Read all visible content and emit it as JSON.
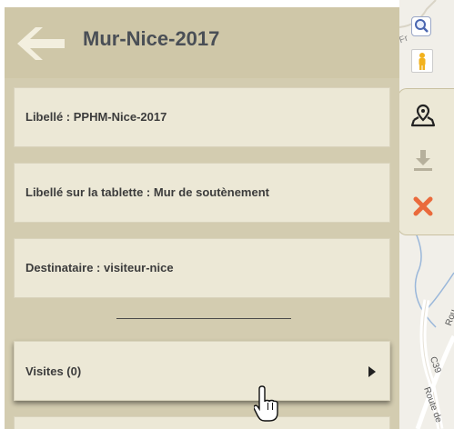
{
  "header": {
    "title": "Mur-Nice-2017"
  },
  "fields": [
    {
      "label": "Libellé : PPHM-Nice-2017"
    },
    {
      "label": "Libellé sur la tablette : Mur de soutènement"
    },
    {
      "label": "Destinataire : visiteur-nice"
    }
  ],
  "visites": {
    "label": "Visites (0)"
  },
  "map": {
    "labels": [
      "Rou",
      "C39",
      "Route de",
      "Fr"
    ]
  },
  "tools": [
    "map-marker-icon",
    "download-icon",
    "close-icon"
  ],
  "colors": {
    "panel": "#d3ccb0",
    "header": "#cfc7a8",
    "box": "#ece8d6",
    "title": "#4a4f56",
    "close": "#ea6a3c"
  }
}
